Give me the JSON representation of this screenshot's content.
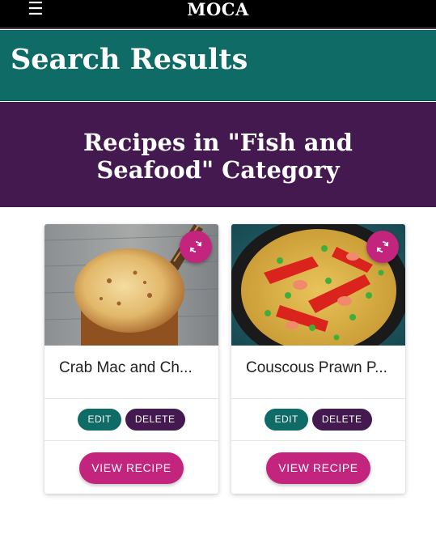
{
  "navbar": {
    "menu_icon": "hamburger-menu-icon",
    "menu_glyph": "☰",
    "brand": "MOCA"
  },
  "page": {
    "title": "Search Results",
    "category_heading": "Recipes in \"Fish and Seafood\" Category"
  },
  "colors": {
    "navbar": "#000000",
    "teal": "#0e6b66",
    "purple": "#43194f",
    "accent_pink": "#c2247e"
  },
  "recipes": [
    {
      "title": "Crab Mac and Ch...",
      "image": "crab-mac-and-cheese-photo",
      "swap_icon": "swap-arrows-icon",
      "edit_label": "EDIT",
      "delete_label": "DELETE",
      "view_label": "VIEW RECIPE"
    },
    {
      "title": "Couscous Prawn P...",
      "image": "couscous-prawn-paella-photo",
      "swap_icon": "swap-arrows-icon",
      "edit_label": "EDIT",
      "delete_label": "DELETE",
      "view_label": "VIEW RECIPE"
    }
  ]
}
